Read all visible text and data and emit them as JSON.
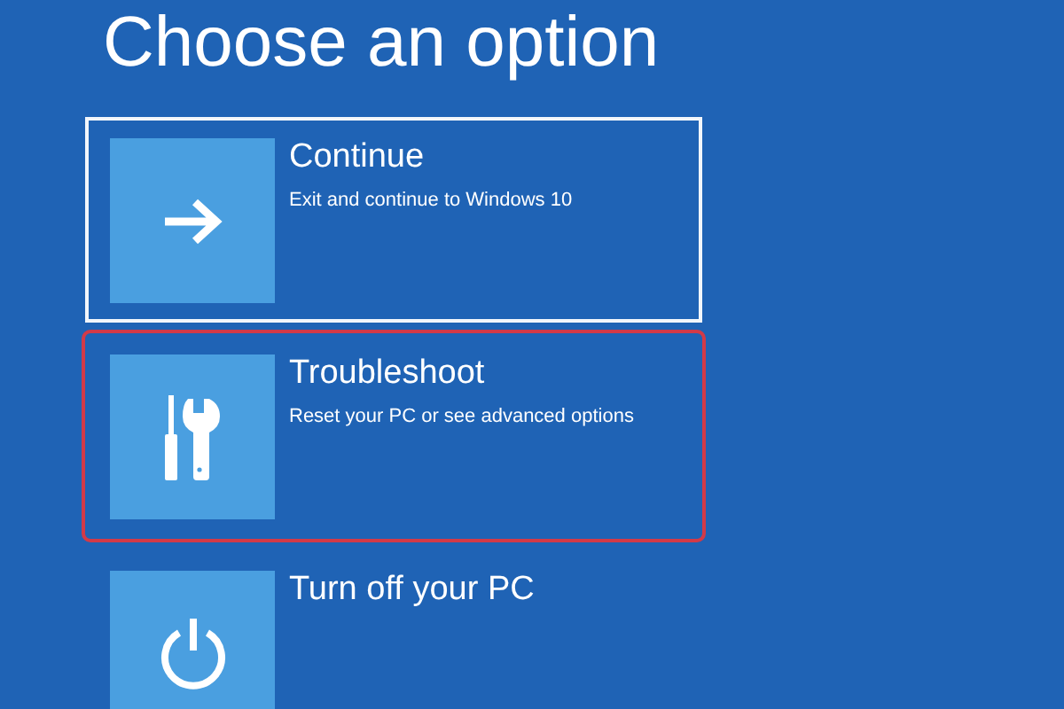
{
  "title": "Choose an option",
  "options": [
    {
      "kind": "arrow",
      "label": "Continue",
      "description": "Exit and continue to Windows 10",
      "selected": true,
      "highlighted": false
    },
    {
      "kind": "tools",
      "label": "Troubleshoot",
      "description": "Reset your PC or see advanced options",
      "selected": false,
      "highlighted": true
    },
    {
      "kind": "power",
      "label": "Turn off your PC",
      "selected": false,
      "highlighted": false
    }
  ]
}
